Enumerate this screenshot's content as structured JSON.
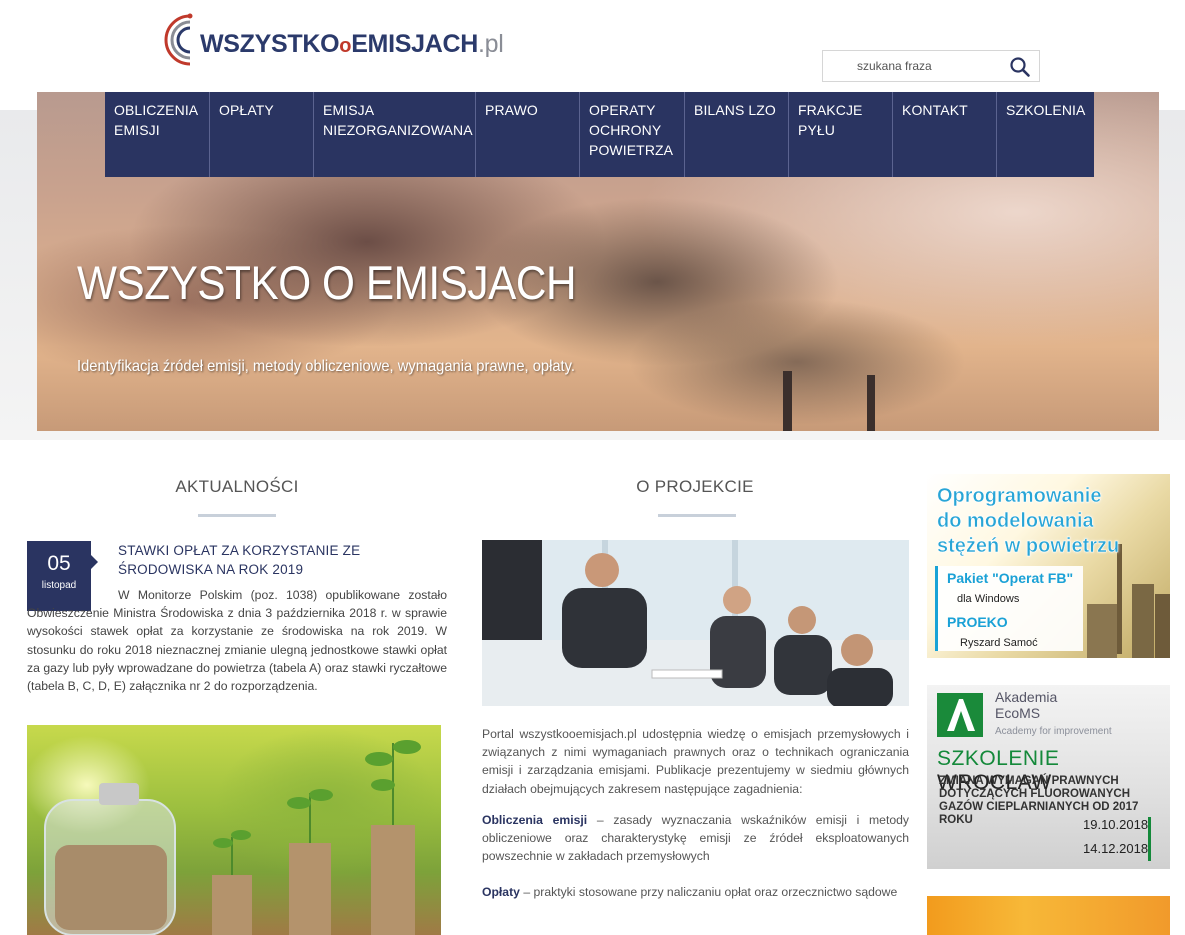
{
  "site": {
    "logo_text_main": "WSZYSTKO",
    "logo_text_o": "o",
    "logo_text_second": "EMISJACH",
    "logo_text_tld": ".pl"
  },
  "search": {
    "placeholder": "szukana fraza"
  },
  "nav": {
    "items": [
      {
        "label": "OBLICZENIA EMISJI"
      },
      {
        "label": "OPŁATY"
      },
      {
        "label": "EMISJA NIEZORGANIZOWANA"
      },
      {
        "label": "PRAWO"
      },
      {
        "label": "OPERATY OCHRONY POWIETRZA"
      },
      {
        "label": "BILANS LZO"
      },
      {
        "label": "FRAKCJE PYŁU"
      },
      {
        "label": "KONTAKT"
      },
      {
        "label": "SZKOLENIA"
      }
    ]
  },
  "hero": {
    "title": "WSZYSTKO O EMISJACH",
    "subtitle": "Identyfikacja źródeł emisji, metody obliczeniowe, wymagania prawne, opłaty."
  },
  "news": {
    "heading": "AKTUALNOŚCI",
    "item": {
      "day": "05",
      "month": "listopad",
      "title": "STAWKI OPŁAT ZA KORZYSTANIE ZE ŚRODOWISKA NA ROK 2019",
      "body": "W Monitorze Polskim (poz. 1038) opublikowane zostało Obwieszczenie Ministra Środowiska z dnia 3 października 2018 r. w sprawie wysokości stawek opłat za korzystanie ze środowiska na rok 2019. W stosunku do roku 2018 nieznacznej zmianie ulegną jednostkowe stawki opłat za gazy lub pyły wprowadzane do powietrza (tabela A) oraz stawki ryczałtowe (tabela B, C, D, E) załącznika nr 2 do rozporządzenia."
    }
  },
  "project": {
    "heading": "O PROJEKCIE",
    "intro": "Portal wszystkooemisjach.pl udostępnia wiedzę o emisjach przemysłowych i związanych z nimi wymaganiach prawnych oraz o technikach ograniczania emisji i zarządzania emisjami. Publikacje prezentujemy w siedmiu głównych działach obejmujących zakresem następujące zagadnienia:",
    "topic1_bold": "Obliczenia emisji",
    "topic1_text": " – zasady wyznaczania wskaźników emisji i metody obliczeniowe oraz charakterystykę emisji ze źródeł eksploatowanych powszechnie w zakładach przemysłowych",
    "topic2_bold": "Opłaty",
    "topic2_text": " – praktyki stosowane przy naliczaniu opłat oraz orzecznictwo sądowe"
  },
  "ads": {
    "ad1": {
      "line1": "Oprogramowanie",
      "line2": "do modelowania",
      "line3": "stężeń w powietrzu",
      "product": "Pakiet \"Operat FB\"",
      "platform": "dla Windows",
      "company": "PROEKO",
      "author": "Ryszard Samoć"
    },
    "ad2": {
      "brand1": "Akademia",
      "brand2": "EcoMS",
      "tagline": "Academy for improvement",
      "headline_green": "SZKOLENIE",
      "headline_dark": "WROCŁAW",
      "topic": "ZMIANA WYMAGAŃ PRAWNYCH DOTYCZĄCYCH FLUOROWANYCH GAZÓW CIEPLARNIANYCH OD 2017 ROKU",
      "date1": "19.10.2018",
      "date2": "14.12.2018"
    }
  },
  "colors": {
    "nav_bg": "#2a3461",
    "accent_green": "#14893a",
    "accent_blue": "#28a5d6"
  }
}
